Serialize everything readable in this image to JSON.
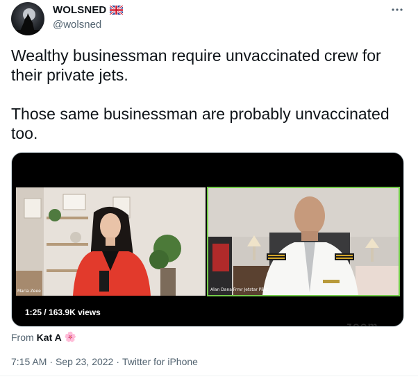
{
  "author": {
    "display_name": "WOLSNED",
    "handle": "@wolsned",
    "flag": "united-kingdom-flag"
  },
  "more_icon": "more-options-icon",
  "tweet": {
    "text": "Wealthy businessman require unvaccinated crew for their private jets.\n\nThose same businessman are probably unvaccinated too."
  },
  "video": {
    "duration": "1:25",
    "views": "163.9K views",
    "left_caption": "Maria Zeee",
    "right_caption": "Alan Dana Frmr Jetstar Pilot",
    "watermark": "zoom",
    "panel_border_color": "#74cc4a"
  },
  "attribution": {
    "prefix": "From",
    "author": "Kat A",
    "emoji": "🌸"
  },
  "meta": {
    "time": "7:15 AM",
    "sep": "·",
    "date": "Sep 23, 2022",
    "source": "Twitter for iPhone"
  }
}
